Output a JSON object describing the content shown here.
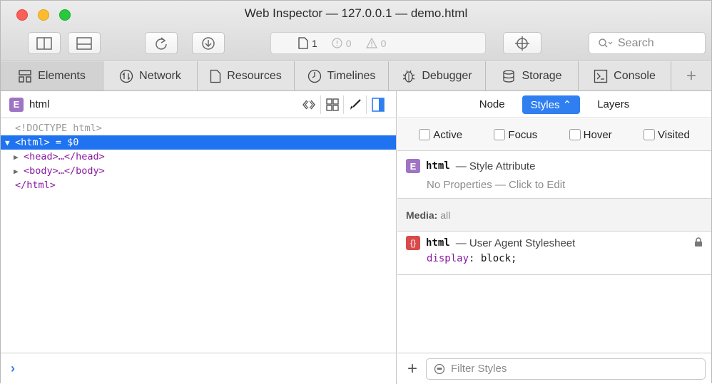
{
  "window": {
    "title": "Web Inspector — 127.0.0.1 — demo.html"
  },
  "toolbar": {
    "activity": {
      "resources_count": "1",
      "errors_count": "0",
      "warnings_count": "0"
    },
    "search_placeholder": "Search"
  },
  "tabs": [
    {
      "label": "Elements",
      "icon": "elements-icon",
      "selected": true
    },
    {
      "label": "Network",
      "icon": "network-icon"
    },
    {
      "label": "Resources",
      "icon": "resources-icon"
    },
    {
      "label": "Timelines",
      "icon": "timelines-icon"
    },
    {
      "label": "Debugger",
      "icon": "debugger-icon"
    },
    {
      "label": "Storage",
      "icon": "storage-icon"
    },
    {
      "label": "Console",
      "icon": "console-icon"
    }
  ],
  "tab_add_label": "+",
  "elements": {
    "breadcrumb_badge": "E",
    "breadcrumb": "html",
    "dom_tree": {
      "doctype": "<!DOCTYPE html>",
      "html_open": "<html>",
      "html_suffix": " = $0",
      "head": "<head>…</head>",
      "body": "<body>…</body>",
      "html_close": "</html>"
    },
    "console_prompt": "›"
  },
  "sidebar": {
    "tabs": [
      "Node",
      "Styles ⌃",
      "Layers"
    ],
    "active_tab": "Styles ⌃",
    "pseudo_classes": [
      "Active",
      "Focus",
      "Hover",
      "Visited"
    ],
    "style_attribute": {
      "badge": "E",
      "selector": "html",
      "origin": "— Style Attribute",
      "empty_text": "No Properties — Click to Edit"
    },
    "media": {
      "label": "Media:",
      "value": "all"
    },
    "ua_rule": {
      "badge": "{}",
      "selector": "html",
      "origin": "— User Agent Stylesheet",
      "property": "display",
      "value": "block"
    },
    "filter_placeholder": "Filter Styles",
    "add_label": "+"
  },
  "colors": {
    "selection": "#1f73f0",
    "accent": "#2f7ff0",
    "tag": "#8a1aa2"
  }
}
